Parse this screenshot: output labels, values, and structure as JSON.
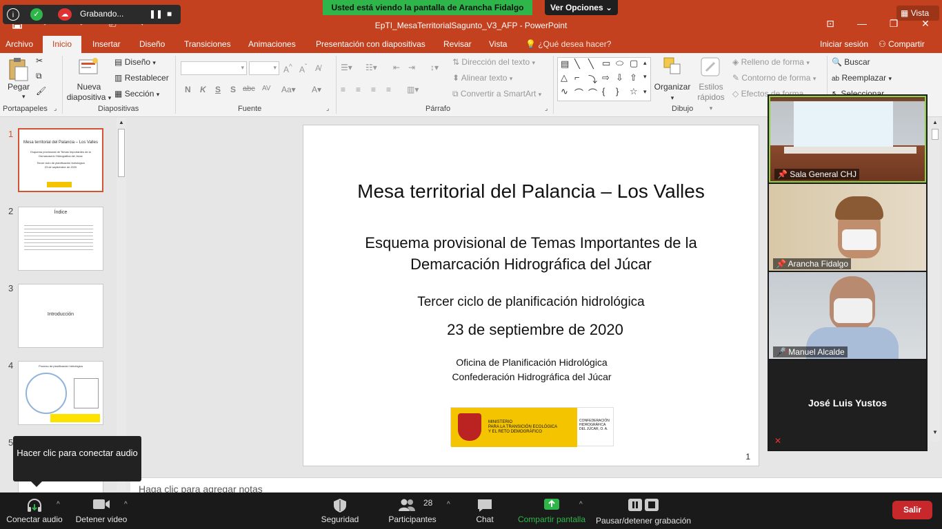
{
  "zoom": {
    "recording_label": "Grabando...",
    "share_banner": "Usted está viendo la pantalla de Arancha Fidalgo",
    "view_options": "Ver Opciones",
    "vista_label": "Vista",
    "audio_tooltip": "Hacer clic para conectar audio",
    "participant_count": "28",
    "bottom": {
      "connect_audio": "Conectar audio",
      "stop_video": "Detener video",
      "security": "Seguridad",
      "participants": "Participantes",
      "chat": "Chat",
      "share_screen": "Compartir pantalla",
      "pause_recording": "Pausar/detener grabación",
      "leave": "Salir"
    },
    "gallery": [
      {
        "name": "Sala General CHJ"
      },
      {
        "name": "Arancha Fidalgo"
      },
      {
        "name": "Manuel Alcalde"
      },
      {
        "name": "José Luis Yustos"
      }
    ]
  },
  "ppt": {
    "doc_title": "EpTI_MesaTerritorialSagunto_V3_AFP - PowerPoint",
    "tabs": [
      "Archivo",
      "Inicio",
      "Insertar",
      "Diseño",
      "Transiciones",
      "Animaciones",
      "Presentación con diapositivas",
      "Revisar",
      "Vista"
    ],
    "search_placeholder": "¿Qué desea hacer?",
    "signin": "Iniciar sesión",
    "share": "Compartir",
    "ribbon": {
      "paste": "Pegar",
      "new_slide_1": "Nueva",
      "new_slide_2": "diapositiva",
      "layout": "Diseño",
      "reset": "Restablecer",
      "section": "Sección",
      "text_direction": "Dirección del texto",
      "align_text": "Alinear texto",
      "smartart": "Convertir a SmartArt",
      "arrange": "Organizar",
      "quick_styles_1": "Estilos",
      "quick_styles_2": "rápidos",
      "shape_fill": "Relleno de forma",
      "shape_outline": "Contorno de forma",
      "shape_effects": "Efectos de forma",
      "find": "Buscar",
      "replace": "Reemplazar",
      "select": "Seleccionar",
      "groups": {
        "clipboard": "Portapapeles",
        "slides": "Diapositivas",
        "font": "Fuente",
        "paragraph": "Párrafo",
        "drawing": "Dibujo"
      }
    },
    "thumbs": [
      {
        "num": "1",
        "title": "Mesa territorial del Palancia – Los Valles",
        "sub1": "Esquema provisional de Temas Importantes de la",
        "sub2": "Demarcación Hidrográfica del Júcar",
        "sub3": "Tercer ciclo de planificación hidrológica",
        "sub4": "23 de septiembre de 2020"
      },
      {
        "num": "2",
        "title": "Índice"
      },
      {
        "num": "3",
        "title": "Introducción"
      },
      {
        "num": "4",
        "title": "Proceso de planificación hidrológica"
      },
      {
        "num": "5"
      }
    ],
    "slide": {
      "title": "Mesa territorial del Palancia – Los Valles",
      "subtitle1": "Esquema provisional de Temas Importantes de la",
      "subtitle2": "Demarcación Hidrográfica del Júcar",
      "cycle": "Tercer ciclo de planificación hidrológica",
      "date": "23 de septiembre de 2020",
      "org1": "Oficina de Planificación Hidrológica",
      "org2": "Confederación Hidrográfica del Júcar",
      "logo_text_a": "MINISTERIO",
      "logo_text_b": "PARA LA TRANSICIÓN ECOLÓGICA",
      "logo_text_c": "Y EL RETO DEMOGRÁFICO",
      "logo_text_d": "CONFEDERACIÓN",
      "logo_text_e": "HIDROGRÁFICA",
      "logo_text_f": "DEL JÚCAR, O. A.",
      "number": "1"
    },
    "notes_placeholder": "Haga clic para agregar notas"
  }
}
